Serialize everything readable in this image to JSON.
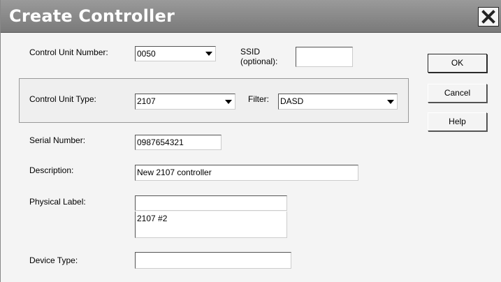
{
  "window": {
    "title": "Create Controller",
    "close_icon": "close-icon"
  },
  "form": {
    "control_unit_number": {
      "label": "Control Unit Number:",
      "value": "0050"
    },
    "ssid": {
      "label_line1": "SSID",
      "label_line2": "(optional):",
      "value": ""
    },
    "control_unit_type": {
      "label": "Control Unit Type:",
      "value": "2107"
    },
    "filter": {
      "label": "Filter:",
      "value": "DASD"
    },
    "serial_number": {
      "label": "Serial Number:",
      "value": "0987654321"
    },
    "description": {
      "label": "Description:",
      "value": "New 2107 controller"
    },
    "physical_label": {
      "label": "Physical Label:",
      "value_line1": "",
      "value_line2": "2107 #2"
    },
    "device_type": {
      "label": "Device Type:",
      "value": ""
    }
  },
  "buttons": {
    "ok": "OK",
    "cancel": "Cancel",
    "help": "Help"
  }
}
